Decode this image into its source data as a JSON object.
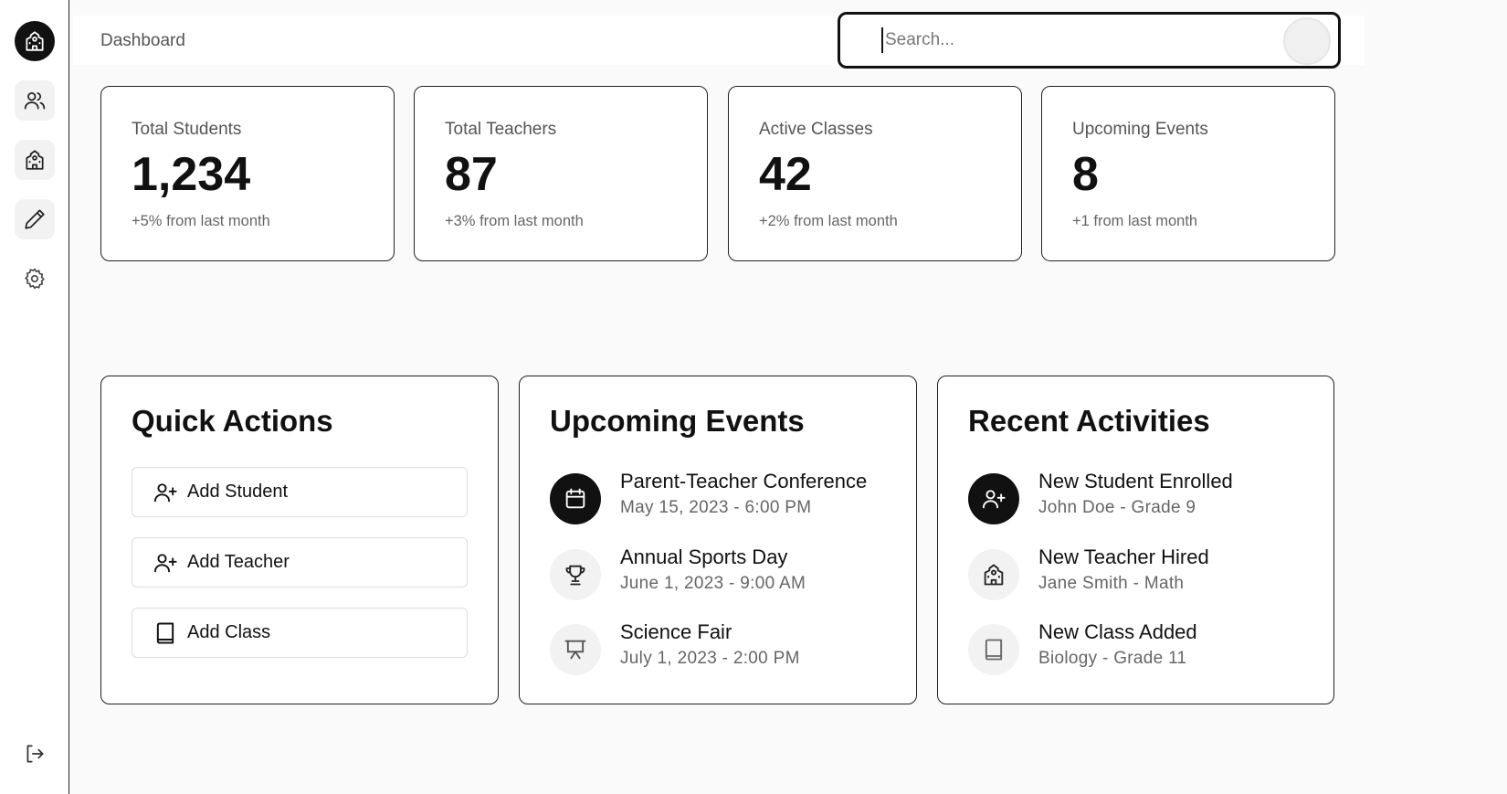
{
  "header": {
    "title": "Dashboard",
    "search_placeholder": "Search..."
  },
  "sidebar": {
    "items": [
      {
        "icon": "school-icon",
        "active": true
      },
      {
        "icon": "users-icon"
      },
      {
        "icon": "school-icon"
      },
      {
        "icon": "pencil-icon"
      },
      {
        "icon": "gear-icon"
      }
    ],
    "logout_icon": "logout-icon"
  },
  "stats": [
    {
      "label": "Total Students",
      "value": "1,234",
      "delta": "+5% from last month"
    },
    {
      "label": "Total Teachers",
      "value": "87",
      "delta": "+3% from last month"
    },
    {
      "label": "Active Classes",
      "value": "42",
      "delta": "+2% from last month"
    },
    {
      "label": "Upcoming Events",
      "value": "8",
      "delta": "+1 from last month"
    }
  ],
  "quick_actions": {
    "title": "Quick Actions",
    "buttons": [
      {
        "label": "Add Student",
        "icon": "user-plus-icon"
      },
      {
        "label": "Add Teacher",
        "icon": "user-plus-icon"
      },
      {
        "label": "Add Class",
        "icon": "book-icon"
      }
    ]
  },
  "upcoming_events": {
    "title": "Upcoming Events",
    "items": [
      {
        "title": "Parent-Teacher Conference",
        "subtitle": "May 15, 2023 - 6:00 PM",
        "icon": "calendar-icon"
      },
      {
        "title": "Annual Sports Day",
        "subtitle": "June 1, 2023 - 9:00 AM",
        "icon": "trophy-icon"
      },
      {
        "title": "Science Fair",
        "subtitle": "July 1, 2023 - 2:00 PM",
        "icon": "presentation-icon"
      }
    ]
  },
  "recent_activities": {
    "title": "Recent Activities",
    "items": [
      {
        "title": "New Student Enrolled",
        "subtitle": "John Doe - Grade 9",
        "icon": "user-plus-icon"
      },
      {
        "title": "New Teacher Hired",
        "subtitle": "Jane Smith - Math",
        "icon": "school-icon"
      },
      {
        "title": "New Class Added",
        "subtitle": "Biology - Grade 11",
        "icon": "book-icon"
      }
    ]
  }
}
